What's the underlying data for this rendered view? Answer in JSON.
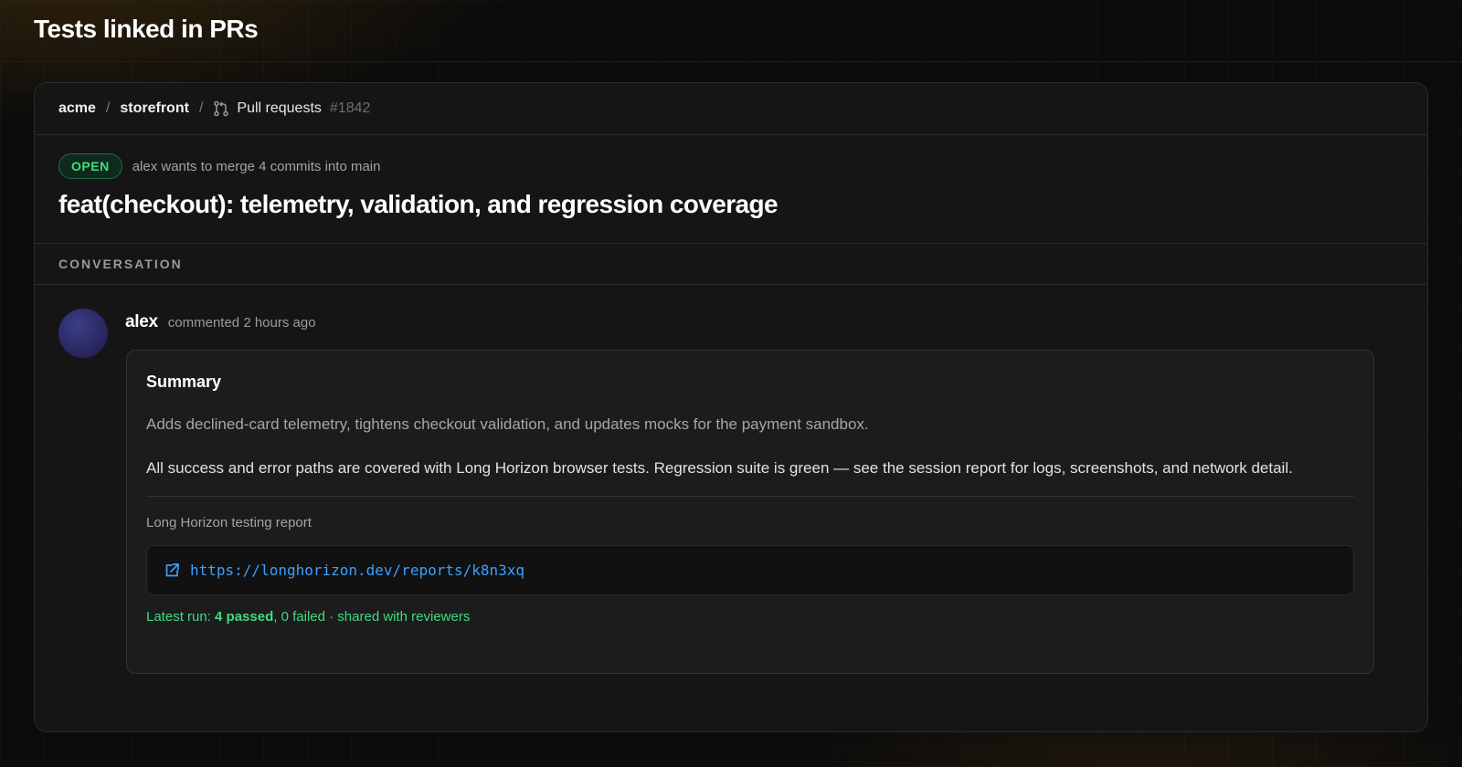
{
  "page": {
    "title": "Tests linked in PRs"
  },
  "breadcrumb": {
    "owner": "acme",
    "repo": "storefront",
    "section": "Pull requests",
    "pr_number": "#1842",
    "separator": "/"
  },
  "pr": {
    "status": "OPEN",
    "merge_text": "alex wants to merge 4 commits into main",
    "title": "feat(checkout): telemetry, validation, and regression coverage"
  },
  "tabs": {
    "conversation": "CONVERSATION"
  },
  "comment": {
    "author": "alex",
    "meta": "commented 2 hours ago",
    "summary_title": "Summary",
    "line1": "Adds declined-card telemetry, tightens checkout validation, and updates mocks for the payment sandbox.",
    "line2": "All success and error paths are covered with Long Horizon browser tests. Regression suite is green — see the session report for logs, screenshots, and network detail.",
    "report_label": "Long Horizon testing report",
    "report_url": "https://longhorizon.dev/reports/k8n3xq",
    "run_prefix": "Latest run: ",
    "run_passed": "4 passed",
    "run_suffix": ", 0 failed · shared with reviewers"
  },
  "colors": {
    "accent_green": "#3ddc84",
    "link_blue": "#3aa0ff",
    "background": "#0b0b0b",
    "card": "#151515"
  },
  "icons": {
    "pull_request": "git-pull-request-icon",
    "external_link": "external-link-icon"
  }
}
